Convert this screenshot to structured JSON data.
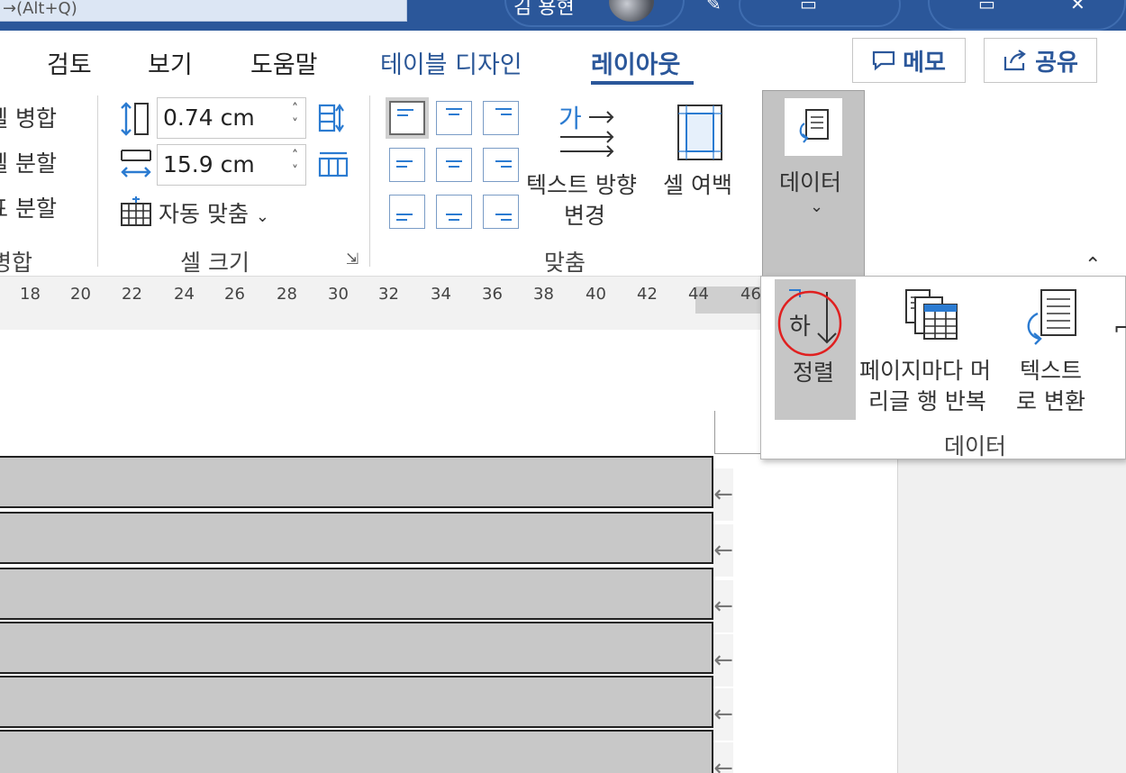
{
  "titlebar": {
    "search_text": "→(Alt+Q)",
    "user_name": "김 용현"
  },
  "tabs": [
    {
      "label": "검토"
    },
    {
      "label": "보기"
    },
    {
      "label": "도움말"
    },
    {
      "label": "테이블 디자인"
    },
    {
      "label": "레이아웃"
    }
  ],
  "actions": {
    "memo": "메모",
    "share": "공유"
  },
  "merge": {
    "merge_cells": "셀 병합",
    "split_cells": "셀 분할",
    "split_table": "표 분할",
    "group": "병합"
  },
  "cell_size": {
    "height": "0.74 cm",
    "width": "15.9 cm",
    "autofit": "자동 맞춤",
    "group": "셀 크기"
  },
  "alignment": {
    "text_direction": "텍스트 방향",
    "text_direction_2": "변경",
    "text_direction_glyph": "가",
    "cell_margins": "셀 여백",
    "group": "맞춤"
  },
  "data_button": "데이터",
  "ruler": [
    "18",
    "20",
    "22",
    "24",
    "26",
    "28",
    "30",
    "32",
    "34",
    "36",
    "38",
    "40",
    "42",
    "44",
    "46"
  ],
  "data_menu": {
    "sort": "정렬",
    "sort_glyph": "하",
    "repeat_header_1": "페이지마다 머",
    "repeat_header_2": "리글 행 반복",
    "convert_1": "텍스트",
    "convert_2": "로 변환",
    "group": "데이터"
  },
  "colors": {
    "titlebar": "#2b579a",
    "accent": "#2b579a",
    "highlight_circle": "#e02020"
  }
}
